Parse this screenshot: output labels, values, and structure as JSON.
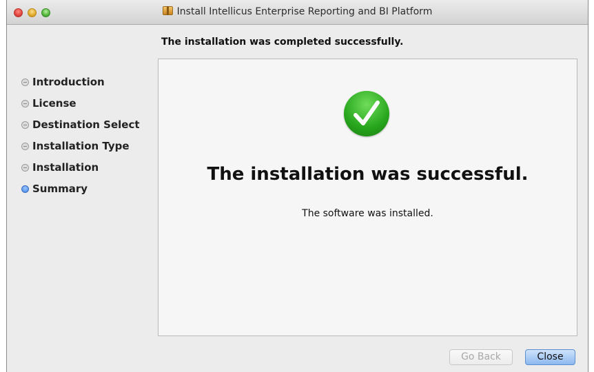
{
  "window": {
    "title": "Install Intellicus Enterprise Reporting and BI Platform",
    "title_icon": "package-icon"
  },
  "header": {
    "text": "The installation was completed successfully."
  },
  "sidebar": {
    "steps": [
      {
        "label": "Introduction",
        "active": false
      },
      {
        "label": "License",
        "active": false
      },
      {
        "label": "Destination Select",
        "active": false
      },
      {
        "label": "Installation Type",
        "active": false
      },
      {
        "label": "Installation",
        "active": false
      },
      {
        "label": "Summary",
        "active": true
      }
    ]
  },
  "main": {
    "status_icon": "checkmark-icon",
    "success_title": "The installation was successful.",
    "message": "The software was installed."
  },
  "buttons": {
    "go_back": "Go Back",
    "close": "Close"
  },
  "colors": {
    "accent_blue": "#3f83e6",
    "success_green": "#27a51c"
  }
}
